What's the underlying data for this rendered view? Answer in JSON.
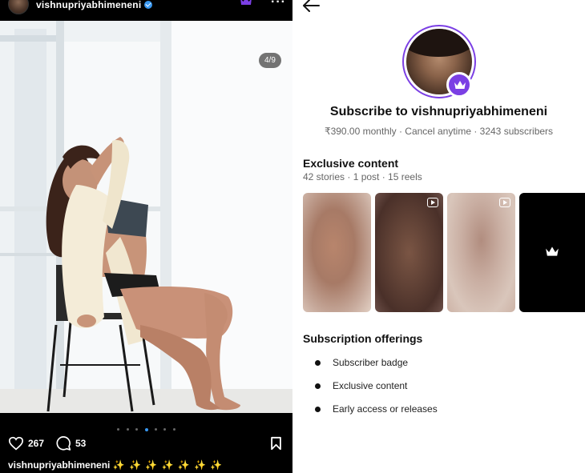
{
  "post": {
    "username": "vishnupriyabhimeneni",
    "pager": "4/9",
    "likes": "267",
    "comments": "53",
    "caption_user": "vishnupriyabhimeneni",
    "caption_text": "✨ ✨ ✨ ✨ ✨ ✨ ✨",
    "carousel_total": 9,
    "carousel_index": 4,
    "icons": [
      "verified-badge-icon",
      "crown-icon",
      "more-options-icon",
      "heart-icon",
      "comment-icon",
      "bookmark-icon"
    ]
  },
  "subscribe": {
    "title": "Subscribe to vishnupriyabhimeneni",
    "info": "₹390.00 monthly · Cancel anytime · 3243 subscribers",
    "exclusive_title": "Exclusive content",
    "exclusive_meta": "42 stories · 1 post · 15 reels",
    "offerings_title": "Subscription offerings",
    "offerings": [
      "Subscriber badge",
      "Exclusive content",
      "Early access or releases"
    ],
    "accent_color": "#7b3fe4"
  }
}
